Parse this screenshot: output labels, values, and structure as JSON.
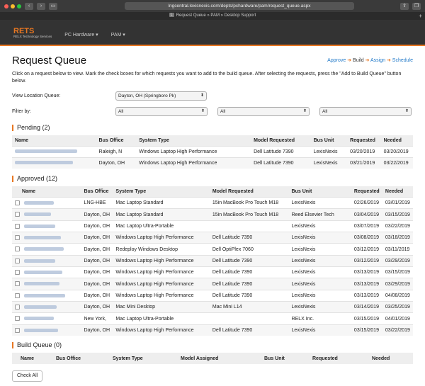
{
  "browser": {
    "url": "lngcentral.lexisnexis.com/depts/pchardware/pam/request_queue.aspx",
    "tab_title": "Request Queue » PAM » Desktop Support",
    "tab_icon": "L",
    "new_tab": "+"
  },
  "header": {
    "logo": "RETS",
    "logo_sub": "RELX Technology Services",
    "nav": [
      "PC Hardware",
      "PAM"
    ]
  },
  "workflow": {
    "steps": [
      "Approve",
      "Build",
      "Assign",
      "Schedule"
    ],
    "current": "Build"
  },
  "page": {
    "title": "Request Queue",
    "instructions": "Click on a request below to view. Mark the check boxes for which requests you want to add to the build queue. After selecting the requests, press the \"Add to Build Queue\" button below.",
    "location_label": "View Location Queue:",
    "location_value": "Dayton, OH (Springboro Pk)",
    "filter_label": "Filter by:",
    "filters": [
      "All",
      "All",
      "All"
    ]
  },
  "pending": {
    "title": "Pending (2)",
    "headers": [
      "Name",
      "Bus Office",
      "System Type",
      "Model Requested",
      "Bus Unit",
      "Requested",
      "Needed"
    ],
    "rows": [
      [
        "Raleigh, N",
        "Windows Laptop High Performance",
        "Dell Latitude 7390",
        "LexisNexis",
        "03/20/2019",
        "03/20/2019"
      ],
      [
        "Dayton, OH",
        "Windows Laptop High Performance",
        "Dell Latitude 7390",
        "LexisNexis",
        "03/21/2019",
        "03/22/2019"
      ]
    ]
  },
  "approved": {
    "title": "Approved (12)",
    "headers": [
      "Name",
      "Bus Office",
      "System Type",
      "Model Requested",
      "Bus Unit",
      "Requested",
      "Needed"
    ],
    "rows": [
      [
        "LNG-HBE",
        "Mac Laptop Standard",
        "15in MacBook Pro Touch M18",
        "LexisNexis",
        "02/26/2019",
        "03/01/2019"
      ],
      [
        "Dayton, OH",
        "Mac Laptop Standard",
        "15in MacBook Pro Touch M18",
        "Reed Elsevier Tech",
        "03/04/2019",
        "03/15/2019"
      ],
      [
        "Dayton, OH",
        "Mac Laptop Ultra-Portable",
        "",
        "LexisNexis",
        "03/07/2019",
        "03/22/2019"
      ],
      [
        "Dayton, OH",
        "Windows Laptop High Performance",
        "Dell Latitude 7390",
        "LexisNexis",
        "03/08/2019",
        "03/18/2019"
      ],
      [
        "Dayton, OH",
        "Redeploy Windows Desktop",
        "Dell OptiPlex 7060",
        "LexisNexis",
        "03/12/2019",
        "03/11/2019"
      ],
      [
        "Dayton, OH",
        "Windows Laptop High Performance",
        "Dell Latitude 7390",
        "LexisNexis",
        "03/12/2019",
        "03/29/2019"
      ],
      [
        "Dayton, OH",
        "Windows Laptop High Performance",
        "Dell Latitude 7390",
        "LexisNexis",
        "03/13/2019",
        "03/15/2019"
      ],
      [
        "Dayton, OH",
        "Windows Laptop High Performance",
        "Dell Latitude 7390",
        "LexisNexis",
        "03/13/2019",
        "03/29/2019"
      ],
      [
        "Dayton, OH",
        "Windows Laptop High Performance",
        "Dell Latitude 7390",
        "LexisNexis",
        "03/13/2019",
        "04/08/2019"
      ],
      [
        "Dayton, OH",
        "Mac Mini Desktop",
        "Mac Mini L14",
        "LexisNexis",
        "03/14/2019",
        "03/25/2019"
      ],
      [
        "New York,",
        "Mac Laptop Ultra-Portable",
        "",
        "RELX Inc.",
        "03/15/2019",
        "04/01/2019"
      ],
      [
        "Dayton, OH",
        "Windows Laptop High Performance",
        "Dell Latitude 7390",
        "LexisNexis",
        "03/15/2019",
        "03/22/2019"
      ]
    ]
  },
  "build_queue": {
    "title": "Build Queue (0)",
    "headers": [
      "Name",
      "Bus Office",
      "System Type",
      "Model Assigned",
      "Bus Unit",
      "Requested",
      "Needed"
    ]
  },
  "buttons": {
    "check_all": "Check All"
  },
  "colors": {
    "accent": "#e87722",
    "link": "#1f78c8",
    "header_bg": "#333333"
  }
}
